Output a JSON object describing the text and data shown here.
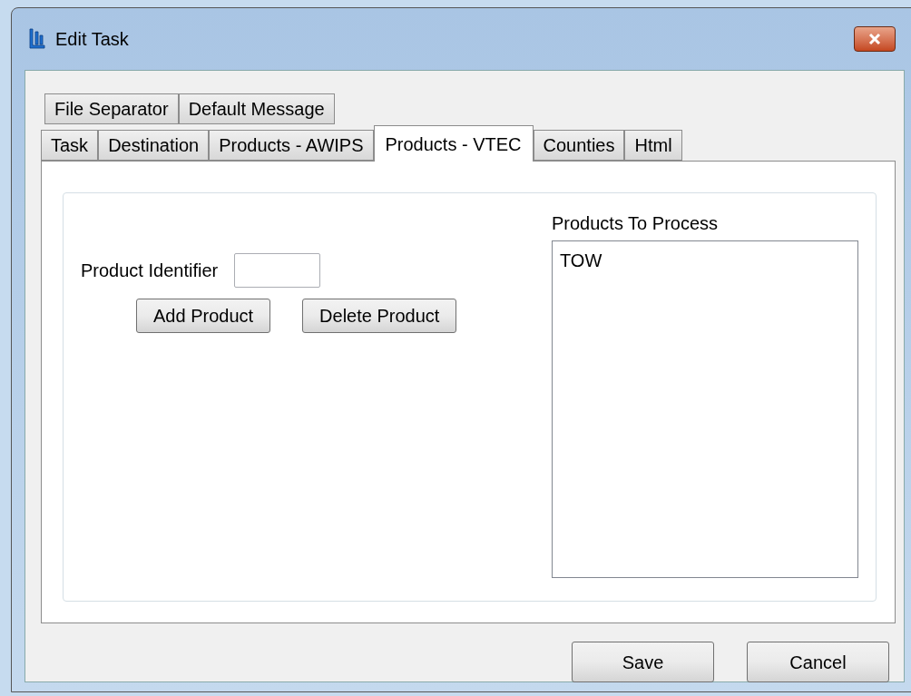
{
  "window": {
    "title": "Edit Task"
  },
  "tab_rows": [
    [
      {
        "label": "File Separator",
        "selected": false
      },
      {
        "label": "Default Message",
        "selected": false
      }
    ],
    [
      {
        "label": "Task",
        "selected": false
      },
      {
        "label": "Destination",
        "selected": false
      },
      {
        "label": "Products - AWIPS",
        "selected": false
      },
      {
        "label": "Products - VTEC",
        "selected": true
      },
      {
        "label": "Counties",
        "selected": false
      },
      {
        "label": "Html",
        "selected": false
      }
    ]
  ],
  "product_identifier": {
    "label": "Product Identifier"
  },
  "product_buttons": [
    "Add Product",
    "Delete Product"
  ],
  "products_list": {
    "label": "Products To Process",
    "items": [
      {
        "label": "TOW",
        "selected": false
      }
    ]
  },
  "buttons": [
    "Save",
    "Cancel"
  ]
}
